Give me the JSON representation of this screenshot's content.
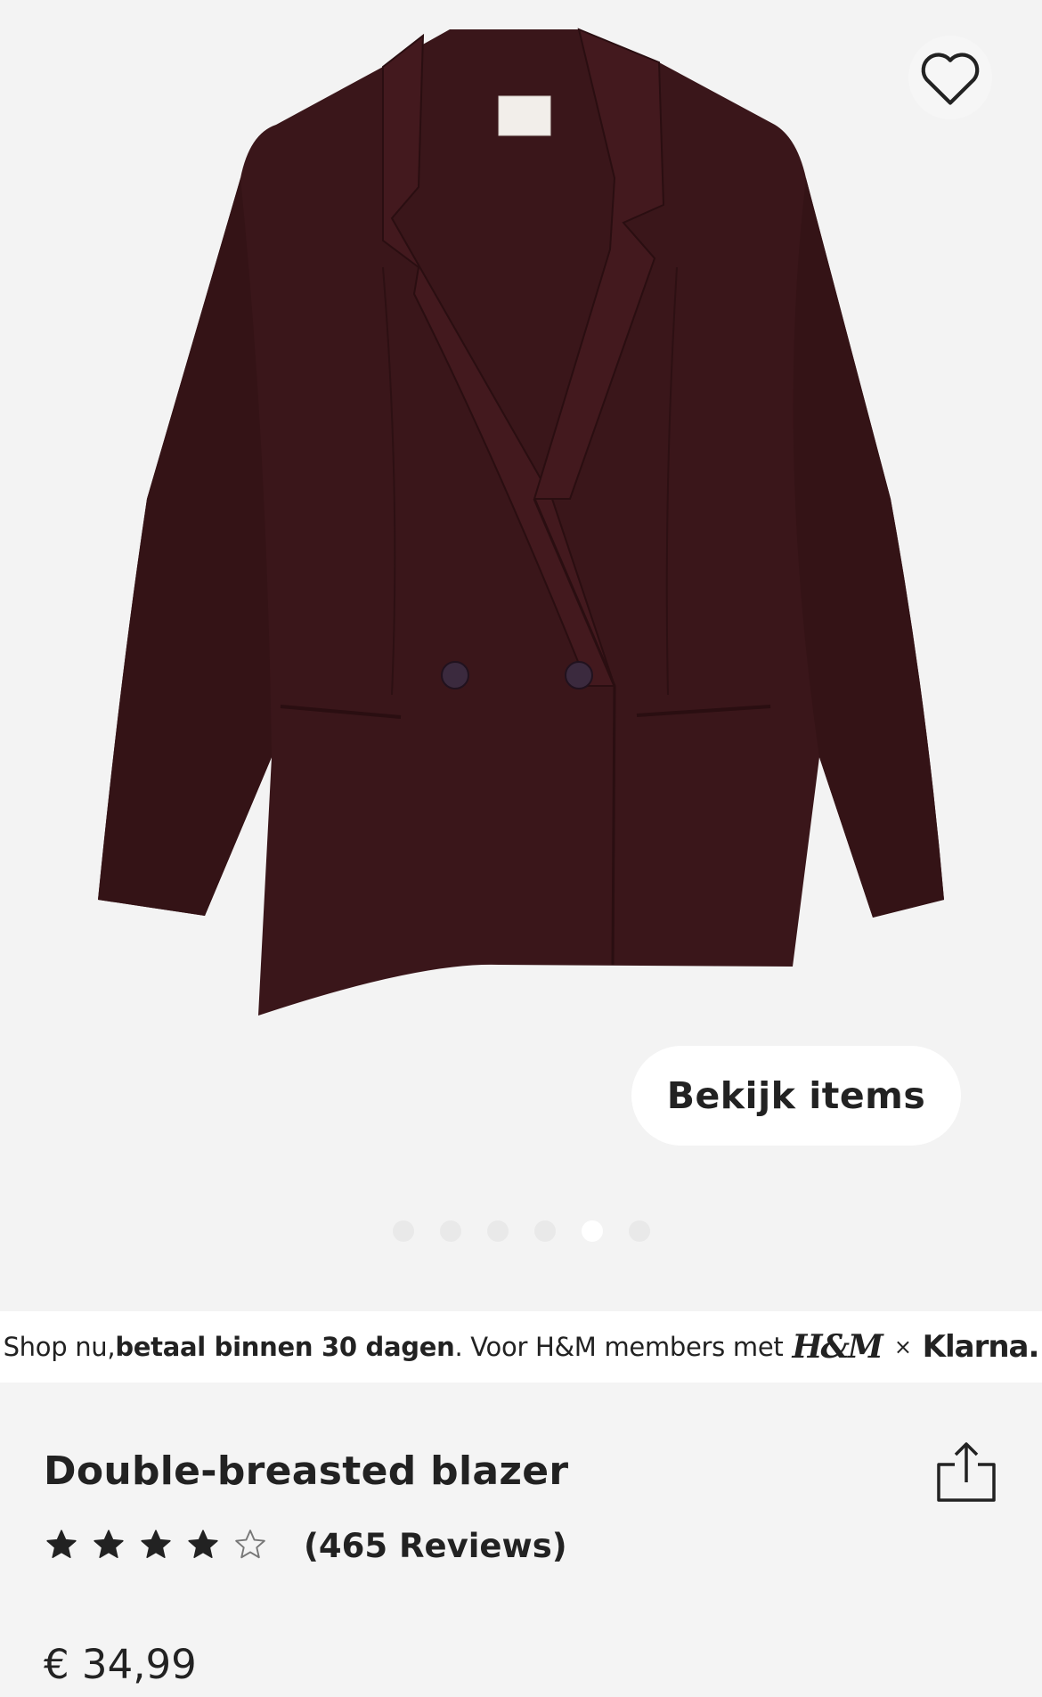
{
  "colors": {
    "garment": "#3a161a",
    "background": "#f4f4f4",
    "text": "#222222"
  },
  "product": {
    "image_alt": "Double-breasted blazer",
    "favorite_icon": "heart-outline-icon",
    "view_items_label": "Bekijk items",
    "carousel": {
      "total": 6,
      "active_index": 4
    },
    "title": "Double-breasted blazer",
    "share_icon": "share-icon",
    "rating": {
      "value": 4,
      "max": 5
    },
    "reviews_label": "(465 Reviews)",
    "price": "€ 34,99"
  },
  "klarna_banner": {
    "text_start": "Shop nu, ",
    "text_bold": "betaal binnen 30 dagen",
    "text_end": ". Voor H&M members met",
    "hm_logo": "H&M",
    "times": "×",
    "klarna_logo": "Klarna."
  }
}
